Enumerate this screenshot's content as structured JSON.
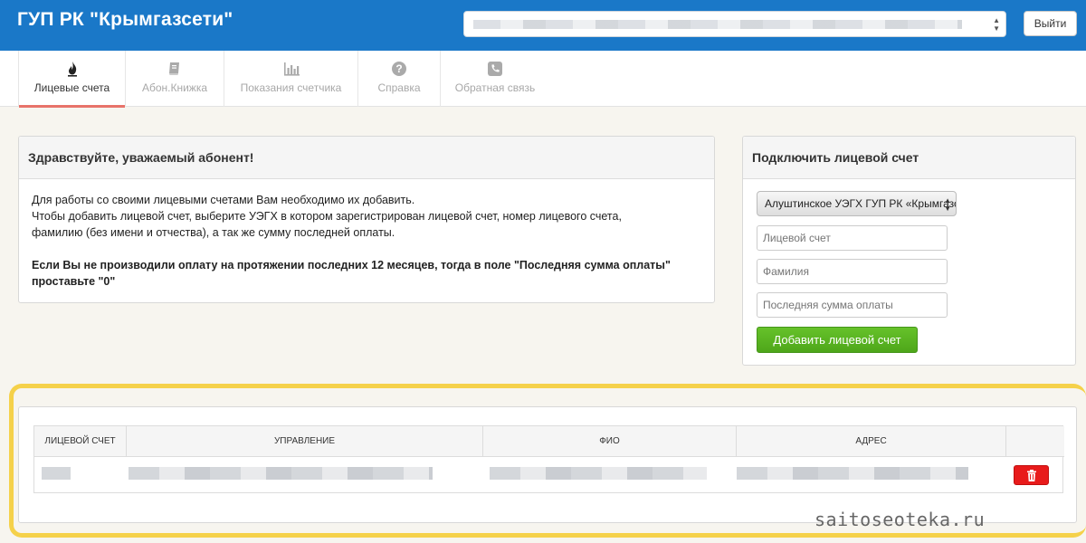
{
  "header": {
    "title": "ГУП РК \"Крымгазсети\"",
    "logout_label": "Выйти",
    "account_select_value": ""
  },
  "tabs": [
    {
      "label": "Лицевые счета",
      "icon": "flame-icon",
      "active": true
    },
    {
      "label": "Абон.Книжка",
      "icon": "book-icon",
      "active": false
    },
    {
      "label": "Показания счетчика",
      "icon": "bar-chart-icon",
      "active": false
    },
    {
      "label": "Справка",
      "icon": "question-icon",
      "active": false
    },
    {
      "label": "Обратная связь",
      "icon": "phone-icon",
      "active": false
    }
  ],
  "welcome": {
    "title": "Здравствуйте, уважаемый абонент!",
    "line1": "Для работы со своими лицевыми счетами Вам необходимо их добавить.",
    "line2": "Чтобы добавить лицевой счет, выберите УЭГХ в котором зарегистрирован лицевой счет, номер лицевого счета,",
    "line3": "фамилию (без имени и отчества), а так же сумму последней оплаты.",
    "bold1": "Если Вы не производили оплату на протяжении последних 12 месяцев, тогда в поле \"Последняя сумма оплаты\"",
    "bold2": "проставьте \"0\""
  },
  "connect": {
    "title": "Подключить лицевой счет",
    "uegx_selected": "Алуштинское УЭГХ ГУП РК «Крымгазсети»",
    "account_placeholder": "Лицевой счет",
    "surname_placeholder": "Фамилия",
    "last_payment_placeholder": "Последняя сумма оплаты",
    "add_button_label": "Добавить лицевой счет"
  },
  "accounts_table": {
    "columns": [
      "Лицевой счет",
      "Управление",
      "ФИО",
      "Адрес"
    ],
    "rows": [
      {
        "account": "",
        "department": "",
        "name": "",
        "address": "",
        "delete_icon": "trash-icon"
      }
    ]
  },
  "watermark": "saitoseoteka.ru",
  "colors": {
    "header_bg": "#1a78c8",
    "active_tab_underline": "#e8736a",
    "add_button": "#5cb421",
    "delete_button": "#e81b1b",
    "highlight_frame": "#f5d14a"
  }
}
